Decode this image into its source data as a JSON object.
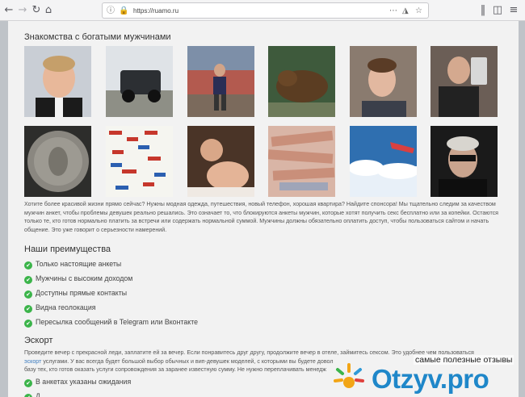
{
  "browser": {
    "url": "https://ruamo.ru",
    "icons": {
      "back": "back-arrow-icon",
      "forward": "forward-arrow-icon",
      "reload": "reload-icon",
      "home": "home-icon",
      "info": "info-icon",
      "lock": "lock-icon",
      "menu": "more-icon",
      "bookmark": "pocket-icon",
      "star": "star-icon",
      "library": "library-icon",
      "sidebar": "sidebar-icon",
      "hamburger": "hamburger-menu-icon"
    }
  },
  "page": {
    "title": "Знакомства с богатыми мужчинами",
    "photos_row1": [
      "photo-man-smiling",
      "photo-jeep-snow",
      "photo-woman-city",
      "photo-bear",
      "photo-young-man",
      "photo-selfie-phone"
    ],
    "photos_row2": [
      "photo-coin",
      "photo-collage",
      "photo-couple",
      "photo-money",
      "photo-airplane-clouds",
      "photo-man-sunglasses"
    ],
    "intro": "Хотите более красивой жизни прямо сейчас? Нужны модная одежда, путешествия, новый телефон, хорошая квартира? Найдите спонсора! Мы тщательно следим за качеством мужчин анкет, чтобы проблемы девушек реально решались. Это означает то, что блокируются анкеты мужчин, которые хотят получить секс бесплатно или за копейки. Остаются только те, кто готов нормально платить за встречи или содержать нормальной суммой. Мужчины должны обязательно оплатить доступ, чтобы пользоваться сайтом и начать общение. Это уже говорит о серьезности намерений.",
    "advantages_title": "Наши преимущества",
    "advantages": [
      "Только настоящие анкеты",
      "Мужчины с высоким доходом",
      "Доступны прямые контакты",
      "Видна геолокация",
      "Пересылка сообщений в Telegram или Вконтакте"
    ],
    "escort_title": "Эскорт",
    "escort_text_1": "Проведите вечер с прекрасной леди, заплатите ей за вечер. Если понравитесь друг другу, продолжите вечер в отеле, займитесь сексом. Это удобнее чем пользоваться",
    "escort_link": "эскорт",
    "escort_text_2": "услугами. У вас всегда будет большой выбор обычных и вип-девушек моделей, с которыми вы будете довол",
    "escort_text_3": "базу тех, кто готов оказать услуги сопровождения за заранее известную сумму. Не нужно переплачивать менедж",
    "escort_items": [
      "В анкетах указаны ожидания",
      "Д"
    ]
  },
  "watermark": {
    "tagline": "самые полезные отзывы",
    "logo": "Otzyv.pro"
  }
}
